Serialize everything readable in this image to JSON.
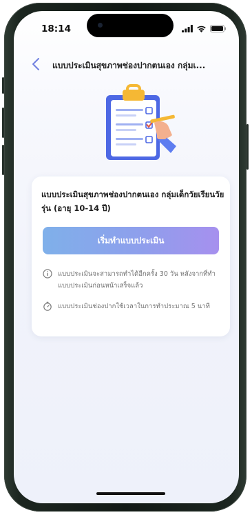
{
  "status_bar": {
    "time": "18:14"
  },
  "header": {
    "title": "แบบประเมินสุขภาพช่องปากตนเอง กลุ่มเ..."
  },
  "card": {
    "title": "แบบประเมินสุขภาพช่องปากตนเอง กลุ่มเด็กวัยเรียนวัยรุ่น (อายุ 10-14 ปี)",
    "start_button_label": "เริ่มทำแบบประเมิน",
    "notes": [
      {
        "icon": "info-icon",
        "text": "แบบประเมินจะสามารถทำได้อีกครั้ง 30 วัน หลังจากที่ทำแบบประเมินก่อนหน้าเสร็จแล้ว"
      },
      {
        "icon": "stopwatch-icon",
        "text": "แบบประเมินช่องปากใช้เวลาในการทำประมาณ 5 นาที"
      }
    ]
  },
  "colors": {
    "button_gradient_start": "#7fb0ea",
    "button_gradient_end": "#a690ee",
    "back_arrow": "#6f7fe0",
    "phone_frame": "#121915"
  }
}
